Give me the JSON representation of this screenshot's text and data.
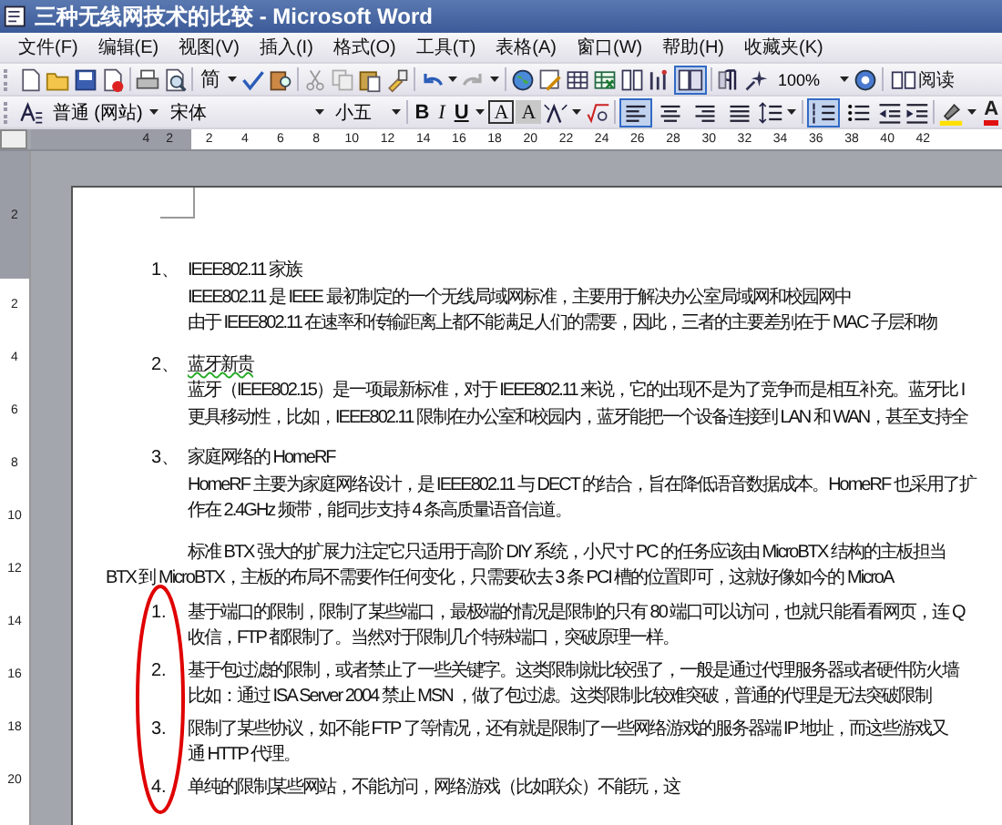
{
  "window": {
    "title": "三种无线网技术的比较 - Microsoft Word"
  },
  "menu": [
    "文件(F)",
    "编辑(E)",
    "视图(V)",
    "插入(I)",
    "格式(O)",
    "工具(T)",
    "表格(A)",
    "窗口(W)",
    "帮助(H)",
    "收藏夹(K)"
  ],
  "standard_toolbar": {
    "script_button": "简",
    "doc_map": {
      "selected": true
    },
    "zoom": "100%",
    "read_button": "阅读"
  },
  "format_toolbar": {
    "style": "普通 (网站)",
    "font": "宋体",
    "size": "小五",
    "text_buttons": [
      "B",
      "I",
      "U",
      "A",
      "A"
    ],
    "font_color_button": "A",
    "align_buttons": [
      {
        "selected": true
      },
      {
        "selected": false
      },
      {
        "selected": false
      },
      {
        "selected": false
      }
    ],
    "list_buttons": [
      {
        "selected": true
      },
      {
        "selected": false
      }
    ]
  },
  "ruler": {
    "left_marks": [
      "4",
      "2"
    ],
    "marks": [
      "2",
      "4",
      "6",
      "8",
      "10",
      "12",
      "14",
      "16",
      "18",
      "20",
      "22",
      "24",
      "26",
      "28",
      "30",
      "32",
      "34",
      "36",
      "38",
      "40",
      "42"
    ]
  },
  "vertical_ruler": {
    "top_marks": [
      "2"
    ],
    "marks": [
      "2",
      "4",
      "6",
      "8",
      "10",
      "12",
      "14",
      "16",
      "18",
      "20"
    ]
  },
  "document": {
    "sections": [
      {
        "number": "1、",
        "heading": "IEEE802.11 家族",
        "lines": [
          "IEEE802.11 是 IEEE 最初制定的一个无线局域网标准，主要用于解决办公室局域网和校园网中",
          "由于 IEEE802.11 在速率和传输距离上都不能满足人们的需要，因此，三者的主要差别在于 MAC 子层和物"
        ]
      },
      {
        "number": "2、",
        "heading": "蓝牙新贵",
        "lines": [
          "蓝牙（IEEE802.15）是一项最新标准，对于 IEEE802.11 来说，它的出现不是为了竞争而是相互补充。蓝牙比 I",
          "更具移动性，比如，IEEE802.11 限制在办公室和校园内，蓝牙能把一个设备连接到 LAN 和 WAN，甚至支持全"
        ]
      },
      {
        "number": "3、",
        "heading": "家庭网络的 HomeRF",
        "lines": [
          "HomeRF 主要为家庭网络设计，是 IEEE802.11 与 DECT 的结合，旨在降低语音数据成本。HomeRF 也采用了扩",
          "作在 2.4GHz 频带，能同步支持 4 条高质量语音信道。"
        ]
      }
    ],
    "paragraph": [
      "标准 BTX 强大的扩展力注定它只适用于高阶 DIY 系统，小尺寸 PC 的任务应该由 MicroBTX 结构的主板担当",
      "BTX 到 MicroBTX，主板的布局不需要作任何变化，只需要砍去 3 条 PCI 槽的位置即可，这就好像如今的 MicroA"
    ],
    "list": [
      {
        "number": "1.",
        "lines": [
          "基于端口的限制，限制了某些端口，最极端的情况是限制的只有 80 端口可以访问，也就只能看看网页，连 Q",
          "收信，FTP 都限制了。当然对于限制几个特殊端口，突破原理一样。"
        ]
      },
      {
        "number": "2.",
        "lines": [
          "基于包过滤的限制，或者禁止了一些关键字。这类限制就比较强了，一般是通过代理服务器或者硬件防火墙",
          "比如：通过 ISA Server 2004 禁止 MSN ，做了包过滤。这类限制比较难突破，普通的代理是无法突破限制"
        ]
      },
      {
        "number": "3.",
        "lines": [
          "限制了某些协议，如不能 FTP 了等情况，还有就是限制了一些网络游戏的服务器端 IP 地址，而这些游戏又",
          "通 HTTP 代理。"
        ]
      },
      {
        "number": "4.",
        "lines": [
          "单纯的限制某些网站，不能访问，网络游戏（比如联众）不能玩，这"
        ]
      }
    ]
  }
}
